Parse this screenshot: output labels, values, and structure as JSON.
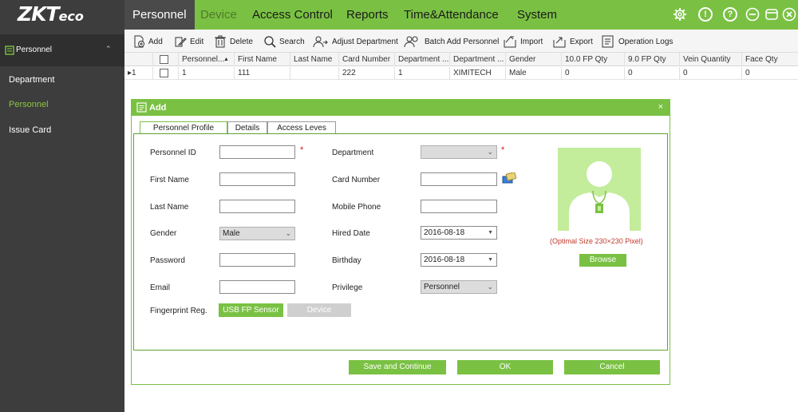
{
  "app": {
    "logo_main": "ZKT",
    "logo_small": "eco"
  },
  "nav": {
    "tabs": [
      "Personnel",
      "Device",
      "Access Control",
      "Reports",
      "Time&Attendance",
      "System"
    ]
  },
  "top_icons": {
    "settings": "gear-icon",
    "info": "info-icon",
    "help": "help-icon",
    "minimize": "minimize-icon",
    "restore": "restore-icon",
    "close": "close-icon"
  },
  "sidebar": {
    "header": "Personnel",
    "items": [
      "Department",
      "Personnel",
      "Issue Card"
    ]
  },
  "toolbar": {
    "items": [
      "Add",
      "Edit",
      "Delete",
      "Search",
      "Adjust Department",
      "Batch Add Personnel",
      "Import",
      "Export",
      "Operation Logs"
    ]
  },
  "table": {
    "headers": [
      "Personnel...",
      "First Name",
      "Last Name",
      "Card Number",
      "Department ...",
      "Department ...",
      "Gender",
      "10.0 FP Qty",
      "9.0 FP Qty",
      "Vein Quantity",
      "Face Qty"
    ],
    "sort_indicator": "▲",
    "rows": [
      {
        "marker": "▸1",
        "cells": [
          "1",
          "111",
          "",
          "222",
          "1",
          "XIMITECH",
          "Male",
          "0",
          "0",
          "0",
          "0"
        ]
      }
    ]
  },
  "dialog": {
    "title": "Add",
    "close": "×",
    "tabs": [
      "Personnel Profile",
      "Details",
      "Access Leves"
    ],
    "left_fields": {
      "personnel_id": {
        "label": "Personnel ID",
        "value": ""
      },
      "first_name": {
        "label": "First Name",
        "value": ""
      },
      "last_name": {
        "label": "Last Name",
        "value": ""
      },
      "gender": {
        "label": "Gender",
        "value": "Male"
      },
      "password": {
        "label": "Password",
        "value": ""
      },
      "email": {
        "label": "Email",
        "value": ""
      },
      "fingerprint": {
        "label": "Fingerprint Reg."
      }
    },
    "right_fields": {
      "department": {
        "label": "Department",
        "value": ""
      },
      "card_number": {
        "label": "Card Number",
        "value": ""
      },
      "mobile_phone": {
        "label": "Mobile Phone",
        "value": ""
      },
      "hired_date": {
        "label": "Hired Date",
        "value": "2016-08-18"
      },
      "birthday": {
        "label": "Birthday",
        "value": "2016-08-18"
      },
      "privilege": {
        "label": "Privilege",
        "value": "Personnel"
      }
    },
    "required_mark": "*",
    "usb_fp_button": "USB FP Sensor",
    "device_button": "Device",
    "photo_hint": "(Optimal Size 230×230 Pixel)",
    "browse_button": "Browse",
    "footer": {
      "save_continue": "Save and Continue",
      "ok": "OK",
      "cancel": "Cancel"
    }
  },
  "colors": {
    "accent": "#7ac143",
    "sidebar": "#3d3d3d",
    "required": "#d11111"
  }
}
